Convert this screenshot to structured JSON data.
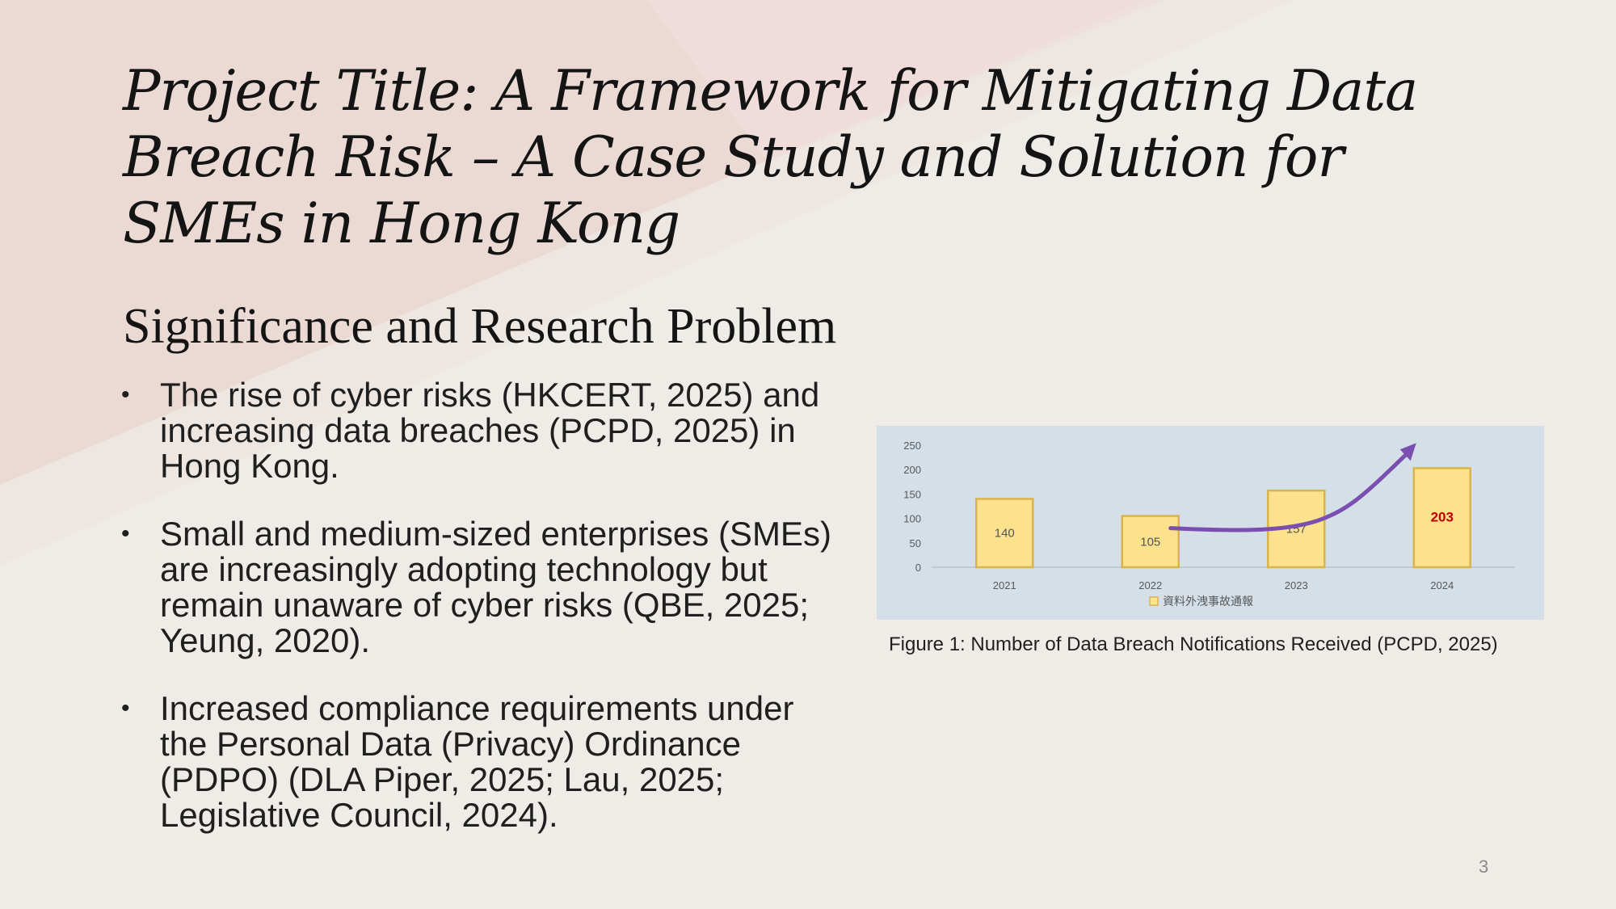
{
  "slide": {
    "title": "Project Title: A Framework for Mitigating Data Breach Risk – A Case Study and Solution for SMEs in Hong Kong",
    "subtitle": "Significance and Research Problem",
    "bullets": [
      "The rise of cyber risks (HKCERT, 2025) and increasing data breaches (PCPD, 2025) in Hong Kong.",
      "Small and medium-sized enterprises (SMEs) are increasingly adopting technology but remain unaware of cyber risks (QBE, 2025; Yeung, 2020).",
      "Increased compliance requirements under the Personal Data (Privacy) Ordinance (PDPO) (DLA Piper, 2025; Lau, 2025; Legislative Council, 2024)."
    ],
    "bullet_symbol": "•",
    "figure_caption": "Figure 1: Number of Data Breach Notifications Received (PCPD, 2025)",
    "page_number": "3"
  },
  "chart_data": {
    "type": "bar",
    "categories": [
      "2021",
      "2022",
      "2023",
      "2024"
    ],
    "values": [
      140,
      105,
      157,
      203
    ],
    "series": [
      {
        "name": "資料外洩事故通報",
        "values": [
          140,
          105,
          157,
          203
        ]
      }
    ],
    "y_ticks": [
      "0",
      "50",
      "100",
      "150",
      "200",
      "250"
    ],
    "ylim": [
      0,
      250
    ],
    "legend_position": "bottom",
    "bar_color": "#fce28c",
    "bar_border_color": "#d9b44a",
    "highlight_label_color": "#c00000",
    "default_label_color": "#555555",
    "trend_arrow_color": "#7a4fb0",
    "grid": false
  }
}
